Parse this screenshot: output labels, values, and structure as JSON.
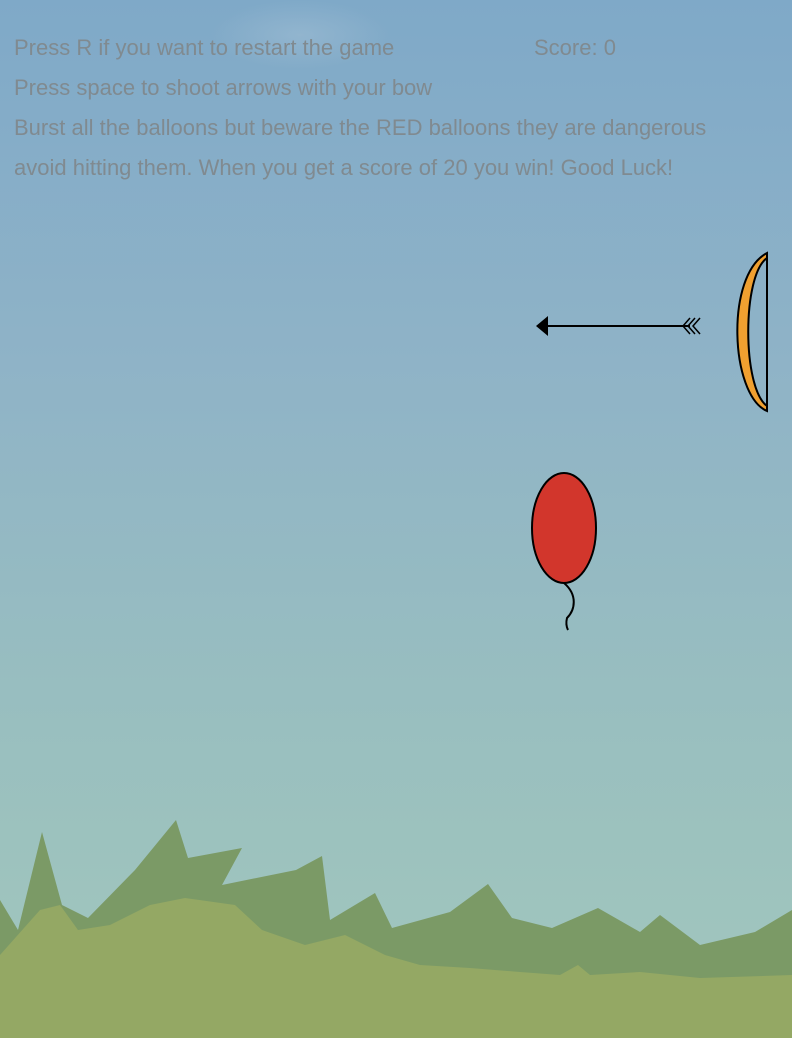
{
  "hud": {
    "restart_hint": "Press R if you want to restart the game",
    "shoot_hint": "Press space to shoot arrows with your bow",
    "rules_line1": "Burst all the balloons but beware the RED balloons they are dangerous",
    "rules_line2": "avoid hitting them. When you get a score of 20 you win! Good Luck!",
    "score_label": "Score: 0"
  },
  "game": {
    "score": 0,
    "win_score": 20
  },
  "colors": {
    "sky_top": "#7fa9c8",
    "sky_bottom": "#a2c7bd",
    "hud_text": "#808a90",
    "balloon_red": "#d2362c",
    "bow_orange": "#f0a030",
    "grass_dark": "#7b9a66",
    "grass_light": "#94a864"
  },
  "sprites": {
    "bow": "bow",
    "arrow": "arrow",
    "balloon": "red-balloon",
    "ground": "grass"
  }
}
